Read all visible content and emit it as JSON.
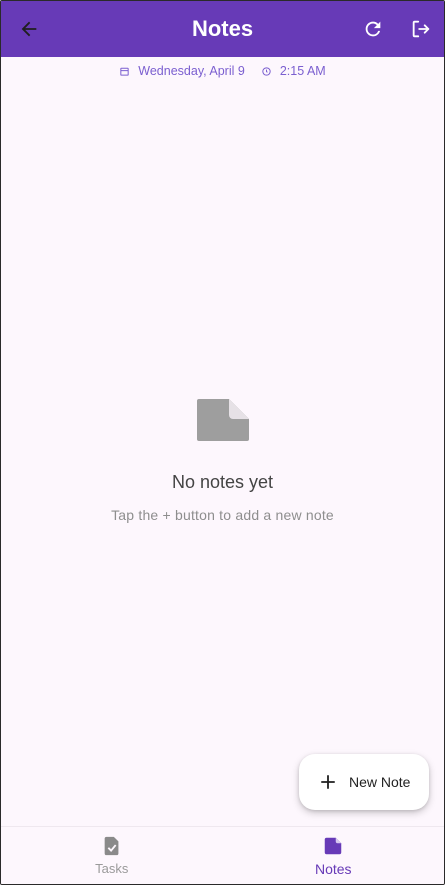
{
  "header": {
    "title": "Notes",
    "back_icon": "arrow-back-icon",
    "refresh_icon": "refresh-icon",
    "logout_icon": "logout-icon",
    "background_color": "#673ab7"
  },
  "datetime": {
    "date": "Wednesday, April 9",
    "time": "2:15 AM",
    "date_icon": "calendar-icon",
    "time_icon": "clock-icon"
  },
  "empty_state": {
    "icon": "note-icon",
    "heading": "No notes yet",
    "message": "Tap the + button to add a new note"
  },
  "fab": {
    "label": "New Note",
    "icon": "plus-icon"
  },
  "bottom_nav": {
    "items": [
      {
        "label": "Tasks",
        "icon": "task-icon",
        "active": false
      },
      {
        "label": "Notes",
        "icon": "note-icon",
        "active": true
      }
    ]
  },
  "colors": {
    "accent": "#673ab7",
    "background": "#fdf7fd"
  }
}
